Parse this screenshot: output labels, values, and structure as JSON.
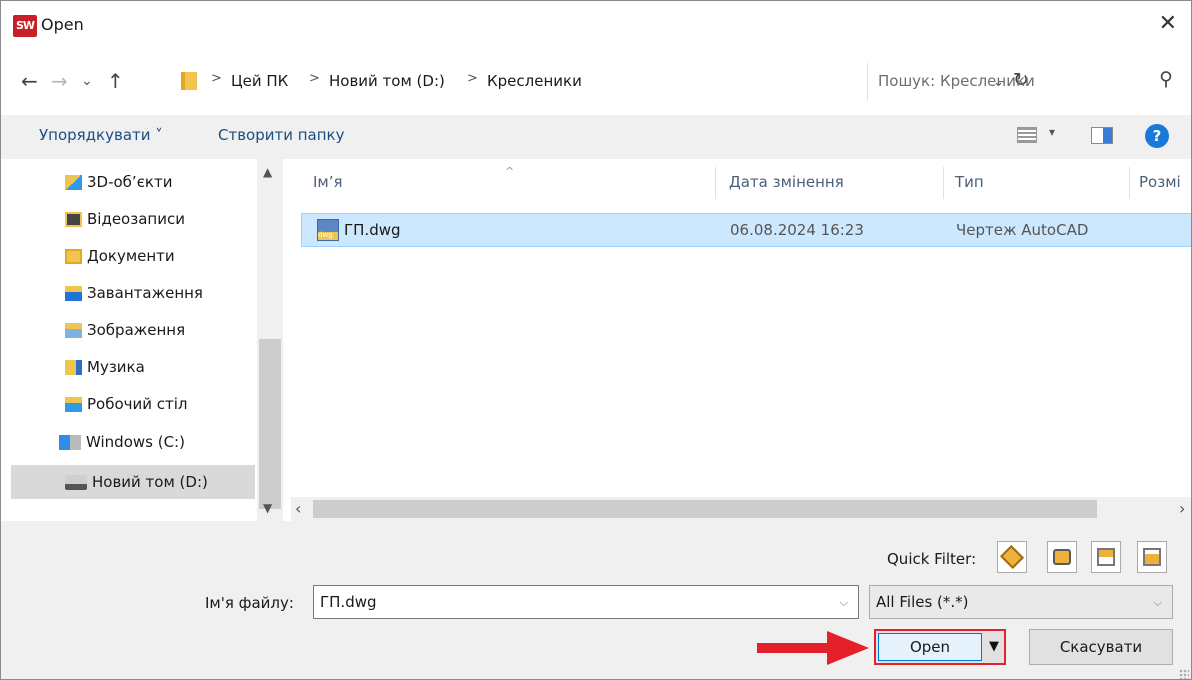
{
  "window": {
    "title": "Open",
    "app_icon": "SW",
    "close_glyph": "✕"
  },
  "address": {
    "breadcrumbs": [
      "Цей ПК",
      "Новий том (D:)",
      "Кресленики"
    ],
    "search_placeholder": "Пошук: Кресленики"
  },
  "toolbar": {
    "organize": "Упорядкувати ˅",
    "new_folder": "Створити папку"
  },
  "nav_pane": {
    "items": [
      {
        "label": "3D-об’єкти",
        "icon": "3d-objects-icon"
      },
      {
        "label": "Відеозаписи",
        "icon": "videos-icon"
      },
      {
        "label": "Документи",
        "icon": "documents-icon"
      },
      {
        "label": "Завантаження",
        "icon": "downloads-icon"
      },
      {
        "label": "Зображення",
        "icon": "pictures-icon"
      },
      {
        "label": "Музика",
        "icon": "music-icon"
      },
      {
        "label": "Робочий стіл",
        "icon": "desktop-icon"
      },
      {
        "label": "Windows (C:)",
        "icon": "windows-drive-icon"
      },
      {
        "label": "Новий том (D:)",
        "icon": "drive-icon",
        "selected": true
      }
    ]
  },
  "file_list": {
    "columns": [
      "Ім’я",
      "Дата змінення",
      "Тип",
      "Розмі"
    ],
    "rows": [
      {
        "name": "ГП.dwg",
        "date": "06.08.2024 16:23",
        "type": "Чертеж AutoCAD",
        "selected": true
      }
    ]
  },
  "bottom": {
    "quick_filter_label": "Quick Filter:",
    "filename_label": "Ім'я файлу:",
    "filename_value": "ГП.dwg",
    "filetype_value": "All Files (*.*)",
    "open_label": "Open",
    "cancel_label": "Скасувати"
  },
  "colors": {
    "selection": "#cce8ff",
    "highlight_border": "#e4212a",
    "arrow": "#e4212a",
    "help": "#1a78d8"
  }
}
